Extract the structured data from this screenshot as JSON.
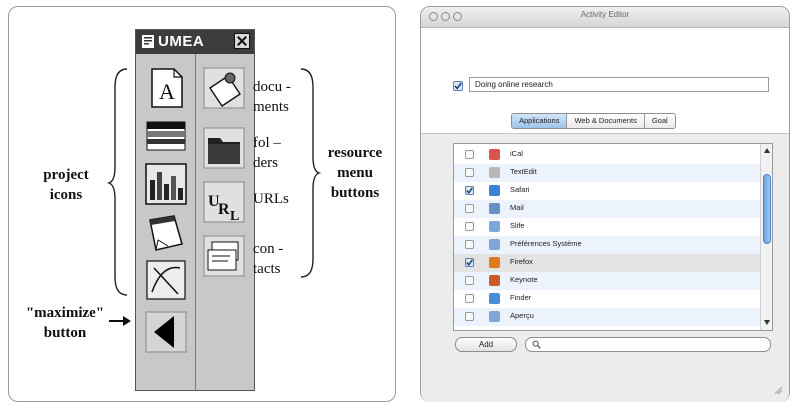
{
  "umea": {
    "title": "UMEA",
    "project_icons": [
      "text-document-icon",
      "color-stripes-icon",
      "bar-chart-icon",
      "notepad-icon",
      "sketch-icon"
    ],
    "resource_buttons": [
      "documents-icon",
      "folders-icon",
      "urls-icon",
      "contacts-icon"
    ],
    "maximize_icon": "triangle-left-icon"
  },
  "annotations": {
    "project_icons": [
      "project",
      "icons"
    ],
    "maximize_button": [
      "\"maximize\"",
      "button"
    ],
    "resource_menu_buttons": [
      "resource",
      "menu",
      "buttons"
    ],
    "documents": [
      "docu -",
      "ments"
    ],
    "folders": [
      "fol –",
      "ders"
    ],
    "urls": "URLs",
    "contacts": [
      "con -",
      "tacts"
    ]
  },
  "activity_editor": {
    "window_title": "Activity Editor",
    "activity_name": "Doing online research",
    "activity_checked": true,
    "tabs": [
      {
        "label": "Applications",
        "active": true
      },
      {
        "label": "Web & Documents",
        "active": false
      },
      {
        "label": "Goal",
        "active": false
      }
    ],
    "apps": [
      {
        "name": "iCal",
        "checked": false,
        "icon": "calendar-icon",
        "color": "#d9534f"
      },
      {
        "name": "TextEdit",
        "checked": false,
        "icon": "textedit-icon",
        "color": "#b8b8b8"
      },
      {
        "name": "Safari",
        "checked": true,
        "icon": "compass-icon",
        "color": "#3b82d6"
      },
      {
        "name": "Mail",
        "checked": false,
        "icon": "mail-icon",
        "color": "#6a8fc2"
      },
      {
        "name": "Slife",
        "checked": false,
        "icon": "app-icon",
        "color": "#7fa8d8"
      },
      {
        "name": "Préférences Système",
        "checked": false,
        "icon": "app-icon",
        "color": "#7fa8d8"
      },
      {
        "name": "Firefox",
        "checked": true,
        "icon": "firefox-icon",
        "color": "#e07a1f"
      },
      {
        "name": "Keynote",
        "checked": false,
        "icon": "keynote-icon",
        "color": "#c95a2a"
      },
      {
        "name": "Finder",
        "checked": false,
        "icon": "finder-icon",
        "color": "#4a8ad8"
      },
      {
        "name": "Aperçu",
        "checked": false,
        "icon": "app-icon",
        "color": "#7fa8d8"
      }
    ],
    "add_label": "Add",
    "search_placeholder": ""
  }
}
